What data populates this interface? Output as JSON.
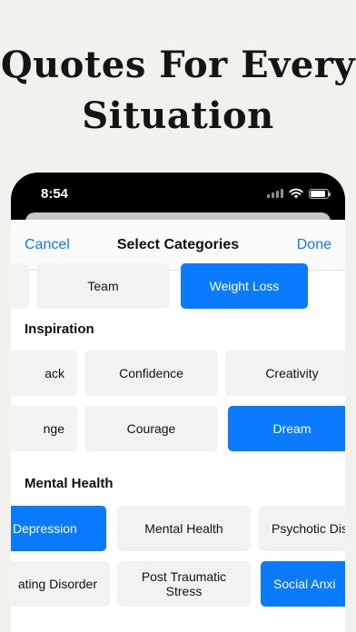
{
  "headline": {
    "line1": "Quotes For Every",
    "line2": "Situation"
  },
  "status_bar": {
    "time": "8:54"
  },
  "nav": {
    "cancel": "Cancel",
    "title": "Select Categories",
    "done": "Done"
  },
  "top_row": [
    {
      "label": "",
      "selected": false
    },
    {
      "label": "Team",
      "selected": false
    },
    {
      "label": "Weight Loss",
      "selected": true
    }
  ],
  "inspiration": {
    "title": "Inspiration",
    "row1": [
      {
        "label": "ack",
        "selected": false
      },
      {
        "label": "Confidence",
        "selected": false
      },
      {
        "label": "Creativity",
        "selected": false
      }
    ],
    "row2": [
      {
        "label": "nge",
        "selected": false
      },
      {
        "label": "Courage",
        "selected": false
      },
      {
        "label": "Dream",
        "selected": true
      }
    ]
  },
  "mental_health": {
    "title": "Mental Health",
    "row1": [
      {
        "label": "Depression",
        "selected": true
      },
      {
        "label": "Mental Health",
        "selected": false
      },
      {
        "label": "Psychotic Dis",
        "selected": false
      }
    ],
    "row2": [
      {
        "label": "ating Disorder",
        "selected": false
      },
      {
        "label": "Post Traumatic Stress",
        "selected": false
      },
      {
        "label": "Social Anxi",
        "selected": true
      }
    ]
  },
  "colors": {
    "accent": "#0a7aff",
    "chip_bg": "#f2f2f2",
    "page_bg": "#f2f1ed"
  }
}
